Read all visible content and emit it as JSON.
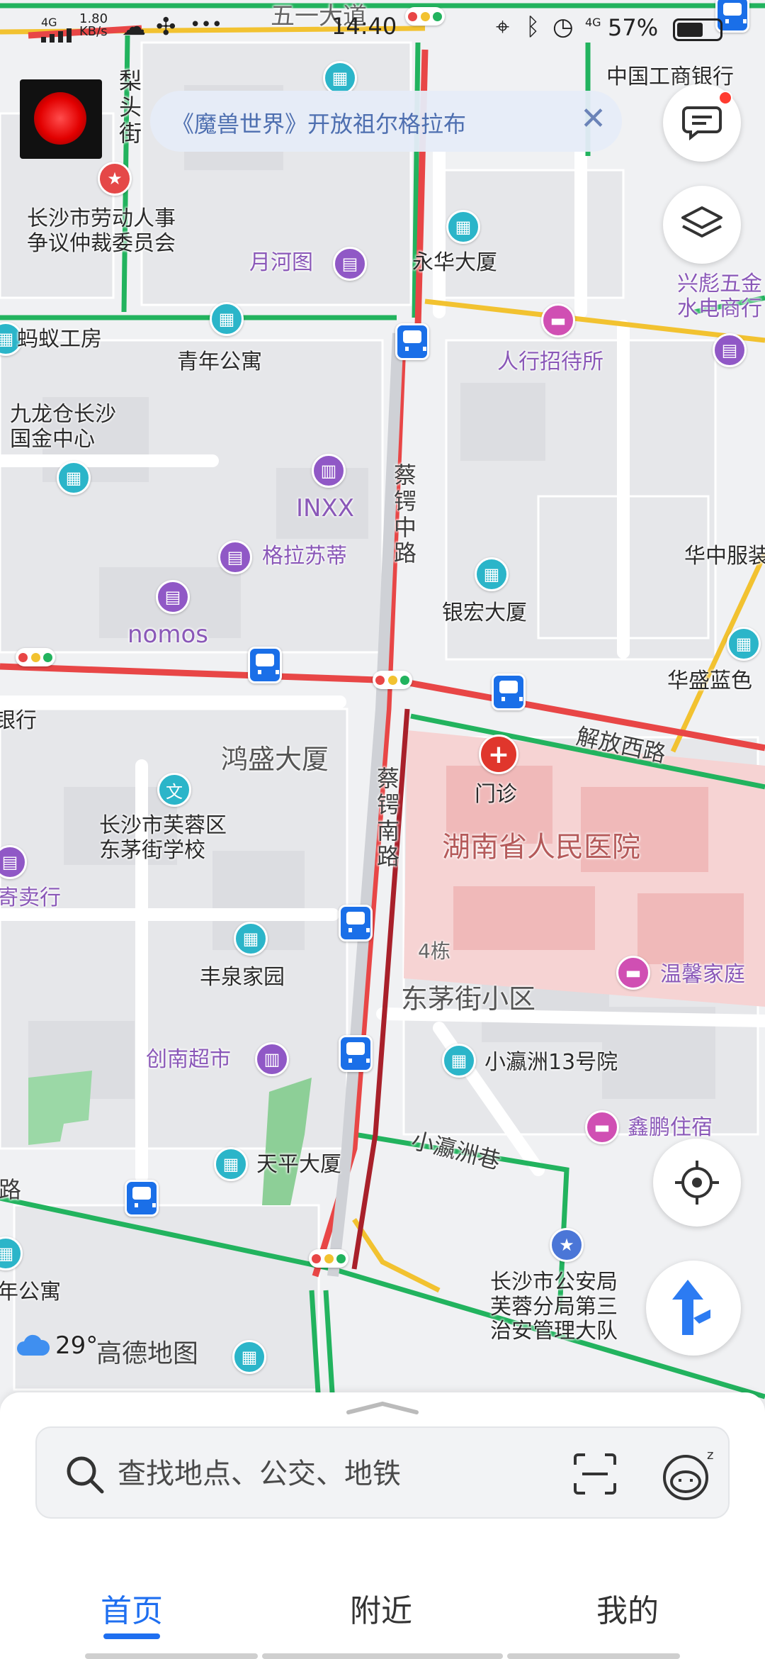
{
  "status_bar": {
    "network": "4G",
    "speed_value": "1.80",
    "speed_unit": "KB/s",
    "more": "•••",
    "time": "14:40",
    "signal_4g": "4G",
    "battery": "57%"
  },
  "banner": {
    "text": "《魔兽世界》开放祖尔格拉布",
    "close_icon": "close-icon"
  },
  "map": {
    "labels": {
      "wuyi_avenue": "五一大道",
      "lijie_street": "梨\n头\n街",
      "icbc": "中国工商银行",
      "labor_committee": "长沙市劳动人事\n争议仲裁委员会",
      "yuehetu": "月河图",
      "yonghua": "永华大厦",
      "xingbiao": "兴彪五金\n水电商行",
      "mayi": "蚂蚁工房",
      "youth_apartment": "青年公寓",
      "renhang_hostel": "人行招待所",
      "jiulong": "九龙仓长沙\n国金中心",
      "inxx": "INXX",
      "glasdi": "格拉苏蒂",
      "caie_middle": "蔡\n锷\n中\n路",
      "huazhong": "华中服装",
      "nomos": "nomos",
      "yinhong": "银宏大厦",
      "huasheng": "华盛蓝色",
      "bank_partial": "银行",
      "jiefang_west": "解放西路",
      "hongsheng": "鸿盛大厦",
      "outpatient": "门诊",
      "caie_south": "蔡\n锷\n南\n路",
      "furong_school": "长沙市芙蓉区\n东茅街学校",
      "hospital": "湖南省人民医院",
      "auction": "寄卖行",
      "building4": "4栋",
      "wenxin": "温馨家庭",
      "fengquan": "丰泉家园",
      "dongmao": "东茅街小区",
      "chuangnan": "创南超市",
      "xiaoyingzhou13": "小瀛洲13号院",
      "xinpeng": "鑫鹏住宿",
      "xiaoyingzhou_lane": "小瀛洲巷",
      "tianping": "天平大厦",
      "road_partial": "路",
      "police": "长沙市公安局\n芙蓉分局第三\n治安管理大队",
      "apartment_partial": "年公寓"
    },
    "weather_temp": "29°",
    "brand": "高德地图"
  },
  "search": {
    "placeholder": "查找地点、公交、地铁"
  },
  "tabs": [
    {
      "label": "首页",
      "active": true
    },
    {
      "label": "附近",
      "active": false
    },
    {
      "label": "我的",
      "active": false
    }
  ],
  "colors": {
    "accent": "#1f6ff0",
    "congested": "#e84646",
    "smooth": "#22b35e",
    "slow": "#f2c230",
    "hospital_area": "#f6d3d3"
  }
}
